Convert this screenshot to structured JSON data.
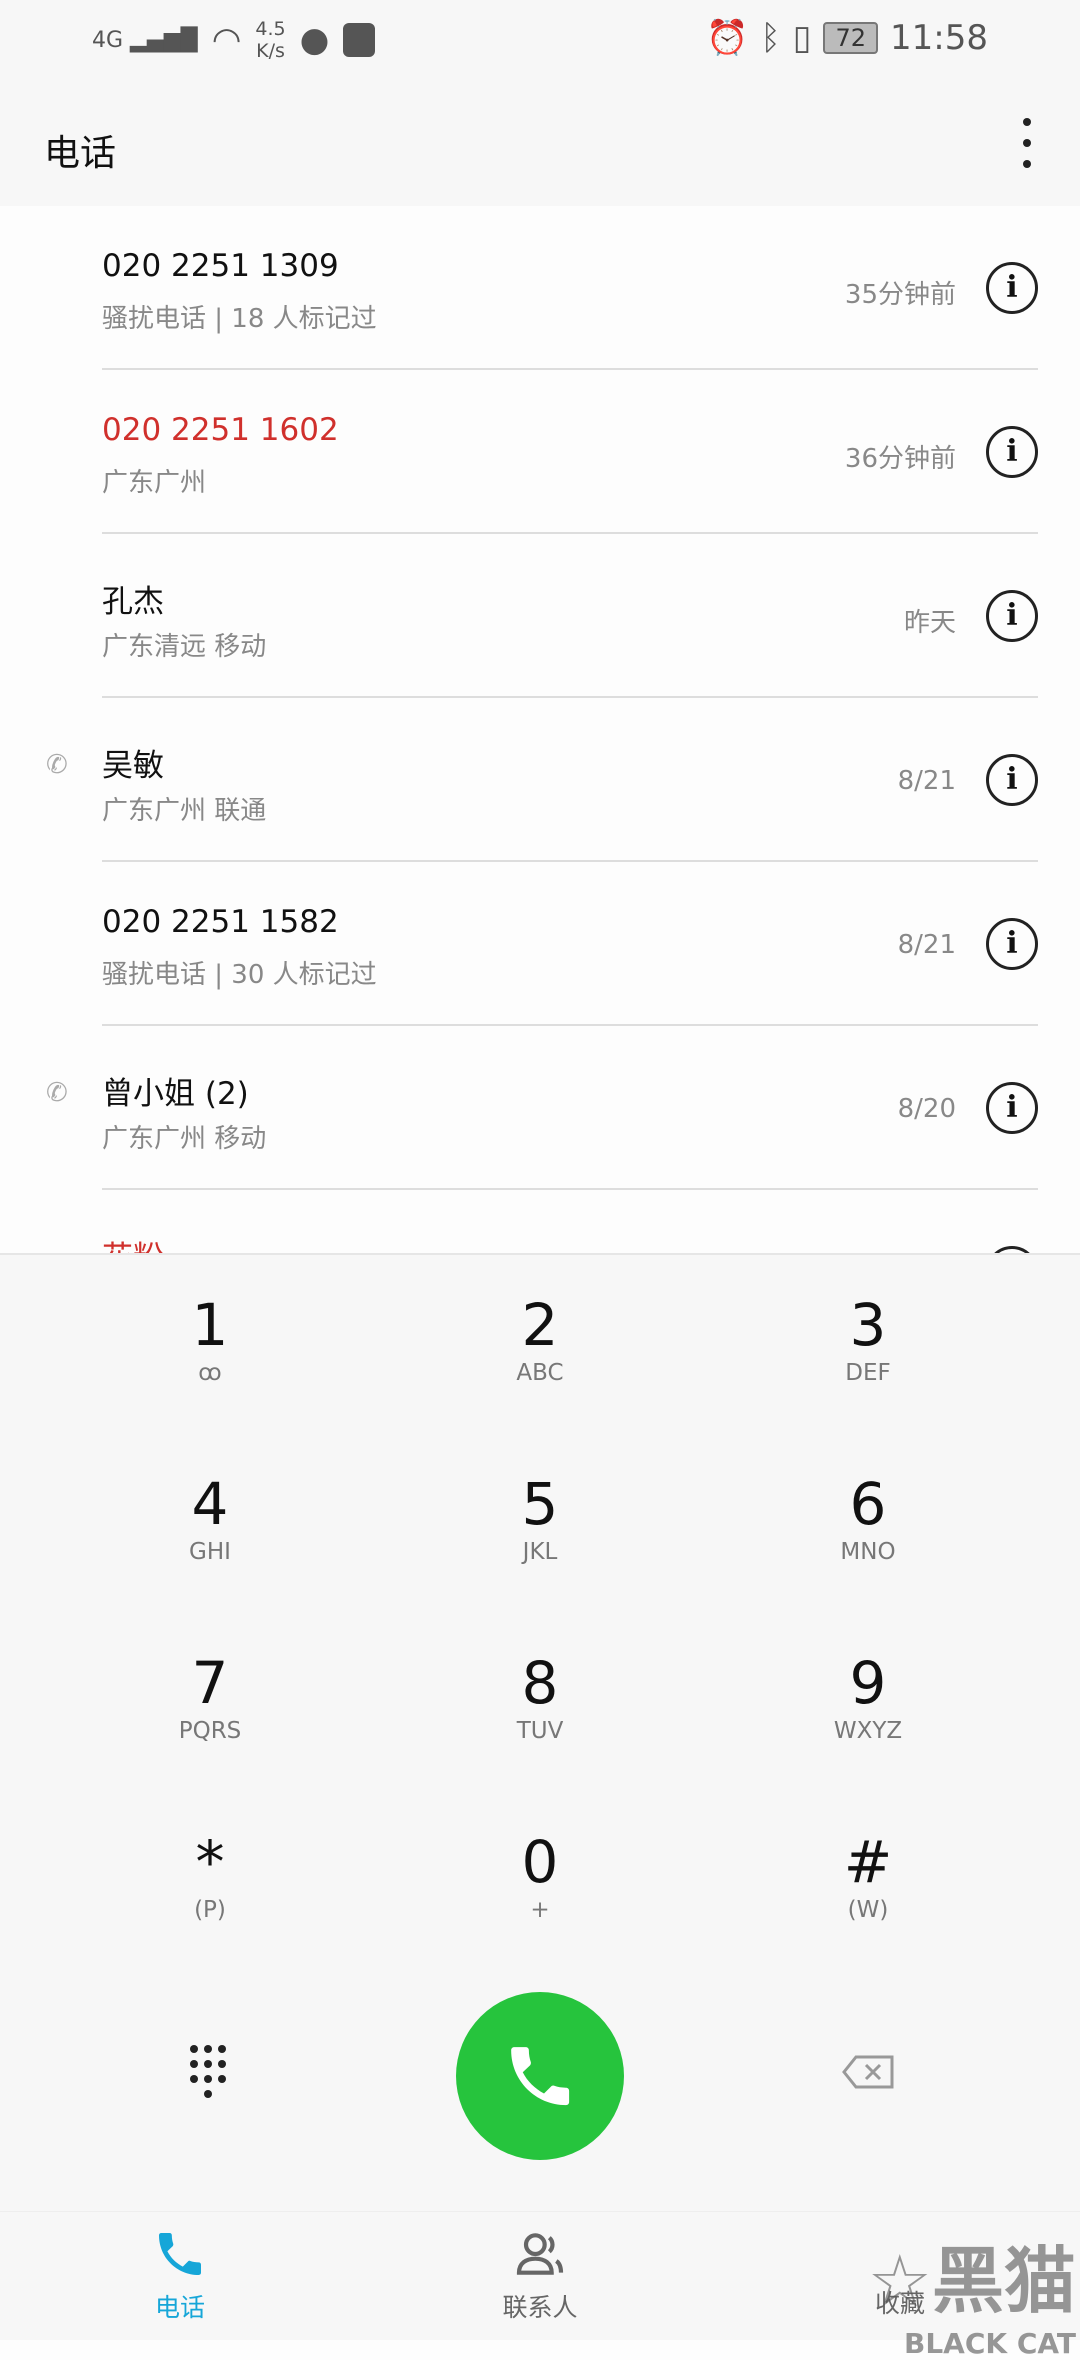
{
  "status_bar": {
    "network": "4G",
    "speed_value": "4.5",
    "speed_unit": "K/s",
    "battery": "72",
    "time": "11:58"
  },
  "header": {
    "title": "电话"
  },
  "calls": [
    {
      "name": "020 2251 1309",
      "detail": "骚扰电话 | 18 人标记过",
      "time": "35分钟前",
      "missed": false,
      "outgoing": false
    },
    {
      "name": "020 2251 1602",
      "detail": "广东广州",
      "time": "36分钟前",
      "missed": true,
      "outgoing": false
    },
    {
      "name": "孔杰",
      "detail": "广东清远 移动",
      "time": "昨天",
      "missed": false,
      "outgoing": false
    },
    {
      "name": "吴敏",
      "detail": "广东广州 联通",
      "time": "8/21",
      "missed": false,
      "outgoing": true
    },
    {
      "name": "020 2251 1582",
      "detail": "骚扰电话 | 30 人标记过",
      "time": "8/21",
      "missed": false,
      "outgoing": false
    },
    {
      "name": "曾小姐 (2)",
      "detail": "广东广州 移动",
      "time": "8/20",
      "missed": false,
      "outgoing": true
    },
    {
      "name": "花粉",
      "detail": "",
      "time": "",
      "missed": true,
      "outgoing": false
    }
  ],
  "dialpad": [
    {
      "digit": "1",
      "letters": "ꝏ"
    },
    {
      "digit": "2",
      "letters": "ABC"
    },
    {
      "digit": "3",
      "letters": "DEF"
    },
    {
      "digit": "4",
      "letters": "GHI"
    },
    {
      "digit": "5",
      "letters": "JKL"
    },
    {
      "digit": "6",
      "letters": "MNO"
    },
    {
      "digit": "7",
      "letters": "PQRS"
    },
    {
      "digit": "8",
      "letters": "TUV"
    },
    {
      "digit": "9",
      "letters": "WXYZ"
    },
    {
      "digit": "*",
      "letters": "(P)"
    },
    {
      "digit": "0",
      "letters": "+"
    },
    {
      "digit": "#",
      "letters": "(W)"
    }
  ],
  "nav": {
    "tabs": [
      {
        "label": "电话",
        "active": true
      },
      {
        "label": "联系人",
        "active": false
      },
      {
        "label": "收藏",
        "active": false
      }
    ]
  },
  "watermark": {
    "text": "黑猫",
    "sub": "BLACK CAT"
  },
  "colors": {
    "accent": "#16a6d8",
    "call": "#26c43d",
    "missed": "#d0302c"
  }
}
